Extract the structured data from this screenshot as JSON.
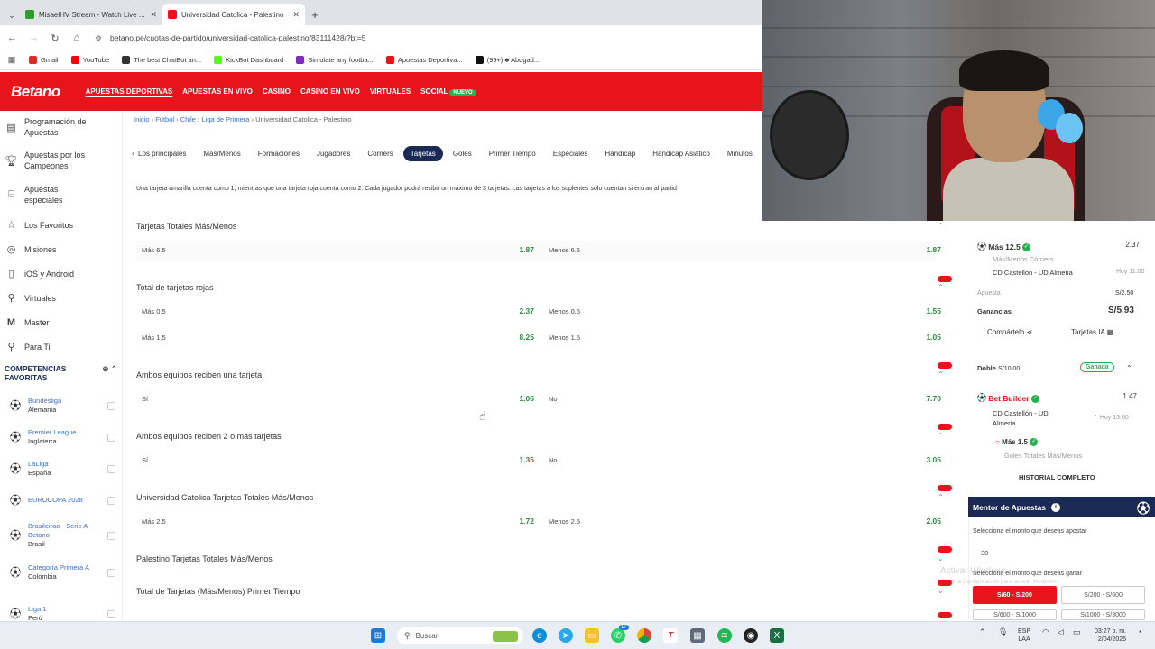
{
  "browser": {
    "tabs": [
      {
        "title": "MisaelHV Stream - Watch Live ...",
        "color": "#2d9f2d"
      },
      {
        "title": "Universidad Catolica - Palestino",
        "color": "#e8141c"
      }
    ],
    "url": "betano.pe/cuotas-de-partido/universidad-catolica-palestino/83111428/?bt=5",
    "bookmarks": [
      {
        "label": "Gmail",
        "color": "#d93025"
      },
      {
        "label": "YouTube",
        "color": "#ff0000"
      },
      {
        "label": "The best ChatBot an...",
        "color": "#333333"
      },
      {
        "label": "KickBot Dashboard",
        "color": "#53fc18"
      },
      {
        "label": "Simulate any footba...",
        "color": "#7b2cbf"
      },
      {
        "label": "Apuestas Deportiva...",
        "color": "#e8141c"
      },
      {
        "label": "(99+) ♣ Abogad...",
        "color": "#111111"
      }
    ]
  },
  "header": {
    "logo": "Betano",
    "nav": [
      "APUESTAS DEPORTIVAS",
      "APUESTAS EN VIVO",
      "CASINO",
      "CASINO EN VIVO",
      "VIRTUALES",
      "SOCIAL"
    ],
    "nuevo_badge": "NUEVO"
  },
  "sidebar": {
    "items": [
      {
        "label": "Programación de Apuestas",
        "icon": "calendar-icon"
      },
      {
        "label": "Apuestas por los Campeones",
        "icon": "trophy-icon"
      },
      {
        "label": "Apuestas especiales",
        "icon": "ticket-icon"
      },
      {
        "label": "Los Favoritos",
        "icon": "star-icon"
      },
      {
        "label": "Misiones",
        "icon": "target-icon"
      },
      {
        "label": "iOS y Android",
        "icon": "phone-icon"
      },
      {
        "label": "Virtuales",
        "icon": "joystick-icon"
      },
      {
        "label": "Master",
        "icon": "m-icon"
      },
      {
        "label": "Para Ti",
        "icon": "search-icon"
      }
    ],
    "competitions_title": "COMPETENCIAS FAVORITAS",
    "competitions": [
      {
        "name": "Bundesliga",
        "country": "Alemania"
      },
      {
        "name": "Premier League",
        "country": "Inglaterra"
      },
      {
        "name": "LaLiga",
        "country": "España"
      },
      {
        "name": "EUROCOPA 2028",
        "country": ""
      },
      {
        "name": "Brasileirao - Serie A Betano",
        "country": "Brasil"
      },
      {
        "name": "Categoría Primera A",
        "country": "Colombia"
      },
      {
        "name": "Liga 1",
        "country": "Perú"
      }
    ]
  },
  "main": {
    "breadcrumb": [
      "Inicio",
      "Fútbol",
      "Chile",
      "Liga de Primera",
      "Universidad Catolica - Palestino"
    ],
    "tabs": [
      "Los principales",
      "Más/Menos",
      "Formaciones",
      "Jugadores",
      "Córners",
      "Tarjetas",
      "Goles",
      "Primer Tiempo",
      "Especiales",
      "Hándicap",
      "Hándicap Asiático",
      "Minutos"
    ],
    "active_tab": "Tarjetas",
    "notice": "Una tarjeta amarilla cuenta como 1, mientras que una tarjeta roja cuenta como 2. Cada jugador podrá recibir un máximo de 3 tarjetas. Las tarjetas a los suplentes sólo cuentan si entran al partid",
    "markets": [
      {
        "title": "Tarjetas Totales Más/Menos",
        "rows": [
          {
            "l1": "Más 6.5",
            "o1": "1.87",
            "l2": "Menos 6.5",
            "o2": "1.87"
          }
        ]
      },
      {
        "title": "Total de tarjetas rojas",
        "rows": [
          {
            "l1": "Más 0.5",
            "o1": "2.37",
            "l2": "Menos 0.5",
            "o2": "1.55"
          },
          {
            "l1": "Más 1.5",
            "o1": "8.25",
            "l2": "Menos 1.5",
            "o2": "1.05"
          }
        ]
      },
      {
        "title": "Ambos equipos reciben una tarjeta",
        "rows": [
          {
            "l1": "Sí",
            "o1": "1.06",
            "l2": "No",
            "o2": "7.70"
          }
        ]
      },
      {
        "title": "Ambos equipos reciben 2 o más tarjetas",
        "rows": [
          {
            "l1": "Sí",
            "o1": "1.35",
            "l2": "No",
            "o2": "3.05"
          }
        ]
      },
      {
        "title": "Universidad Catolica Tarjetas Totales Más/Menos",
        "rows": [
          {
            "l1": "Más 2.5",
            "o1": "1.72",
            "l2": "Menos 2.5",
            "o2": "2.05"
          }
        ]
      },
      {
        "title": "Palestino Tarjetas Totales Más/Menos",
        "rows": []
      },
      {
        "title": "Total de Tarjetas (Más/Menos) Primer Tiempo",
        "rows": []
      }
    ]
  },
  "slip": {
    "sel1_label": "Más 12.5",
    "sel1_odds": "2.37",
    "sel1_market": "Más/Menos Córners",
    "sel1_match": "CD Castellón - UD Almeria",
    "sel1_time": "Hoy 11:00",
    "apuesta_label": "Apuesta",
    "apuesta_value": "S/2.50",
    "ganancias_label": "Ganancias",
    "ganancias_value": "S/5.93",
    "share_label": "Compártelo",
    "ia_label": "Tarjetas IA",
    "doble_label": "Doble",
    "doble_value": "S/10.00",
    "ganada_badge": "Ganada",
    "bb_label": "Bet Builder",
    "bb_odds": "1.47",
    "bb_match": "CD Castellón - UD Almeria",
    "bb_time": "Hoy 13:00",
    "sel2_label": "Más 1.5",
    "sel2_market": "Goles Totales Más/Menos",
    "history": "HISTORIAL COMPLETO",
    "mentor_title": "Mentor de Apuestas",
    "mentor_q1": "Selecciona el monto que deseas apostar",
    "mentor_amount": "30",
    "mentor_q2": "Selecciona el monto que deseas ganar",
    "ranges": [
      "S/60 - S/200",
      "S/200 - S/600",
      "S/600 - S/1000",
      "S/1000 - S/3000"
    ],
    "watermark1": "Activar Windows",
    "watermark2": "Ve a Configuración para activar Windows."
  },
  "taskbar": {
    "search_placeholder": "Buscar",
    "lang1": "ESP",
    "lang2": "LAA",
    "time": "03:27 p. m.",
    "date": "2/04/2026",
    "whatsapp_badge": "17"
  }
}
